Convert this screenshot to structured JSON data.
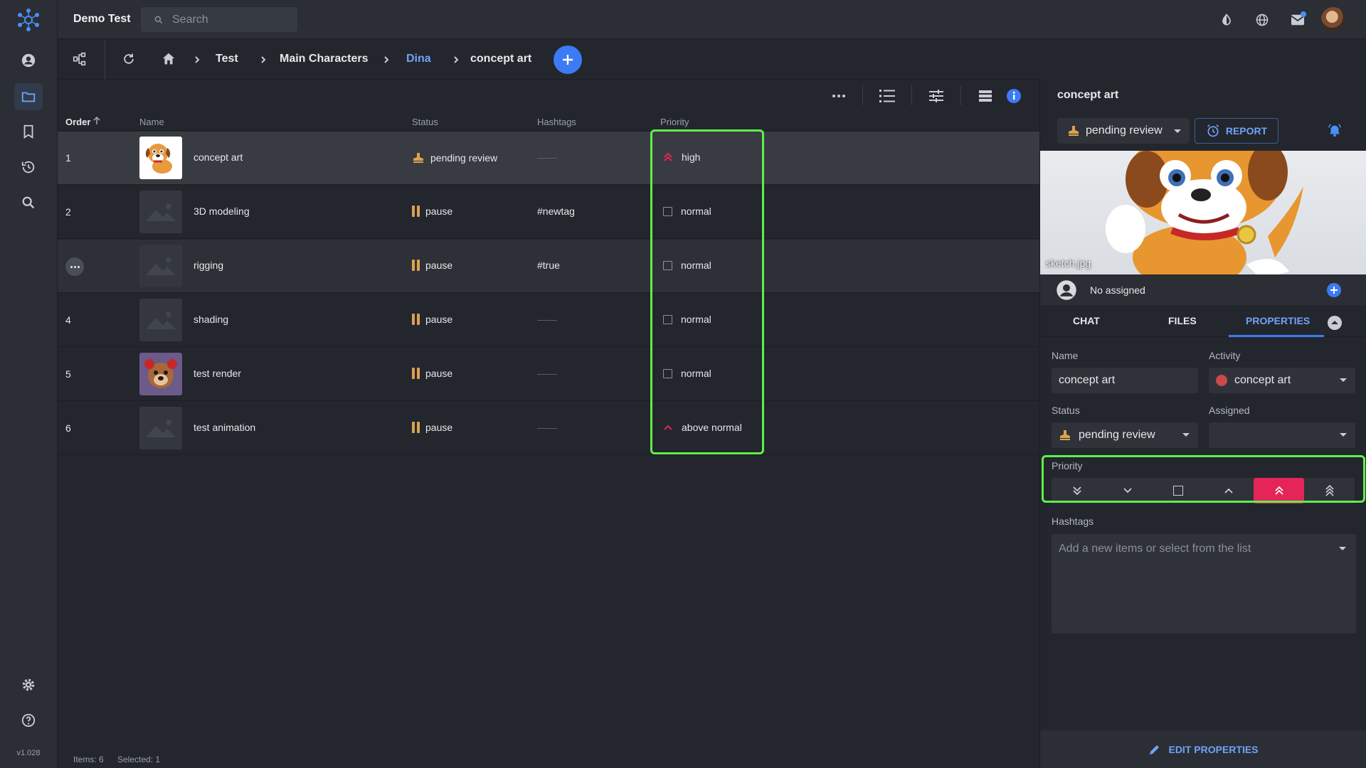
{
  "app": {
    "title": "Demo Test",
    "version": "v1.028"
  },
  "search": {
    "placeholder": "Search"
  },
  "breadcrumb": {
    "items": [
      "Test",
      "Main Characters",
      "Dina",
      "concept art"
    ]
  },
  "table": {
    "headers": {
      "order": "Order",
      "name": "Name",
      "status": "Status",
      "hashtags": "Hashtags",
      "priority": "Priority"
    },
    "rows": [
      {
        "order": "1",
        "name": "concept art",
        "status": "pending review",
        "hashtags": "——",
        "priority": "high"
      },
      {
        "order": "2",
        "name": "3D modeling",
        "status": "pause",
        "hashtags": "#newtag",
        "priority": "normal"
      },
      {
        "order": "3",
        "name": "rigging",
        "status": "pause",
        "hashtags": "#true",
        "priority": "normal"
      },
      {
        "order": "4",
        "name": "shading",
        "status": "pause",
        "hashtags": "——",
        "priority": "normal"
      },
      {
        "order": "5",
        "name": "test render",
        "status": "pause",
        "hashtags": "——",
        "priority": "normal"
      },
      {
        "order": "6",
        "name": "test animation",
        "status": "pause",
        "hashtags": "——",
        "priority": "above normal"
      }
    ]
  },
  "statusbar": {
    "items": "Items: 6",
    "selected": "Selected: 1"
  },
  "panel": {
    "title": "concept art",
    "status": "pending review",
    "report_label": "REPORT",
    "preview_filename": "sketch.jpg",
    "assigned_text": "No assigned",
    "tabs": [
      "CHAT",
      "FILES",
      "PROPERTIES"
    ],
    "active_tab": "PROPERTIES",
    "fields": {
      "name_label": "Name",
      "name_value": "concept art",
      "activity_label": "Activity",
      "activity_value": "concept art",
      "status_label": "Status",
      "status_value": "pending review",
      "assigned_label": "Assigned",
      "assigned_value": "",
      "priority_label": "Priority",
      "hashtags_label": "Hashtags",
      "hashtags_placeholder": "Add a new items or select from the list"
    },
    "priority_options": [
      "lowest",
      "below normal",
      "normal",
      "above normal",
      "high",
      "highest"
    ],
    "priority_selected": "high",
    "edit_label": "EDIT PROPERTIES"
  },
  "colors": {
    "accent": "#3c7bf4",
    "priority_active": "#e5245a",
    "highlight": "#5ef04a",
    "activity_dot": "#c94a4a",
    "pause": "#d9a350"
  }
}
